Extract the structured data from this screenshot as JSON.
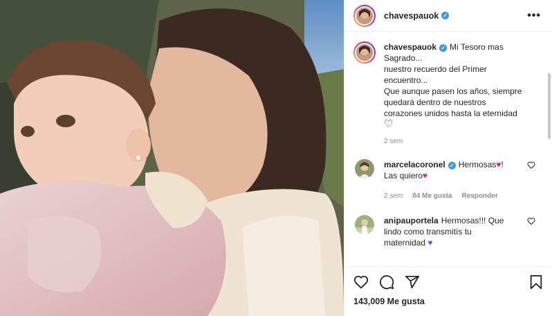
{
  "post": {
    "author": "chavespauok",
    "caption_lines": [
      "Mi Tesoro mas",
      "Sagrado...",
      "nuestro recuerdo del Primer",
      "encuentro...",
      "Que aunque pasen los años, siempre",
      "quedará dentro de nuestros",
      "corazones unidos hasta la eternidad"
    ],
    "caption_heart": "♡",
    "caption_age": "2 sem",
    "likes_count": "143,009",
    "likes_suffix": "Me gusta"
  },
  "comments": [
    {
      "user": "marcelacoronel",
      "verified": true,
      "text_a": "Hermosas",
      "heart_a": "♥",
      "text_b": "!",
      "text_c": "Las quiero",
      "heart_b": "♥",
      "age": "2 sem",
      "likes": "84 Me gusta",
      "reply": "Responder"
    },
    {
      "user": "anipauportela",
      "verified": false,
      "text_a": "Hermosas!!! Que",
      "text_b": "lindo como transmitís tu",
      "text_c": "maternidad",
      "heart": "♥"
    }
  ],
  "icons": {
    "more": "more-options-icon",
    "like": "heart-icon",
    "comment": "comment-icon",
    "share": "share-icon",
    "save": "bookmark-icon"
  },
  "colors": {
    "verified_blue": "#3897f0",
    "heart_red": "#e0245e",
    "muted_text": "#8e8e8e"
  }
}
